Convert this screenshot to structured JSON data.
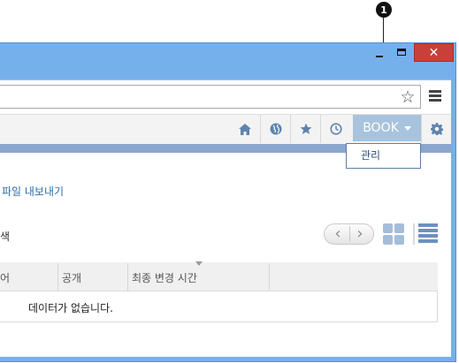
{
  "callout": {
    "number": "1"
  },
  "window": {
    "minimize_label": "–",
    "close_label": "✕"
  },
  "toolbar": {
    "icons": [
      "home-icon",
      "globe-icon",
      "star-icon",
      "clock-icon",
      "gear-icon"
    ],
    "book_label": "BOOK"
  },
  "dropdown": {
    "items": [
      {
        "label": "관리"
      }
    ]
  },
  "page": {
    "export_link": "파일 내보내기",
    "search_label": "색"
  },
  "table": {
    "columns": [
      "어",
      "공개",
      "최종 변경 시간"
    ],
    "empty_message": "데이터가 없습니다."
  },
  "colors": {
    "frame": "#76b0ec",
    "close": "#c7403a",
    "accent": "#a8c3dd",
    "link": "#2e6ea8"
  }
}
